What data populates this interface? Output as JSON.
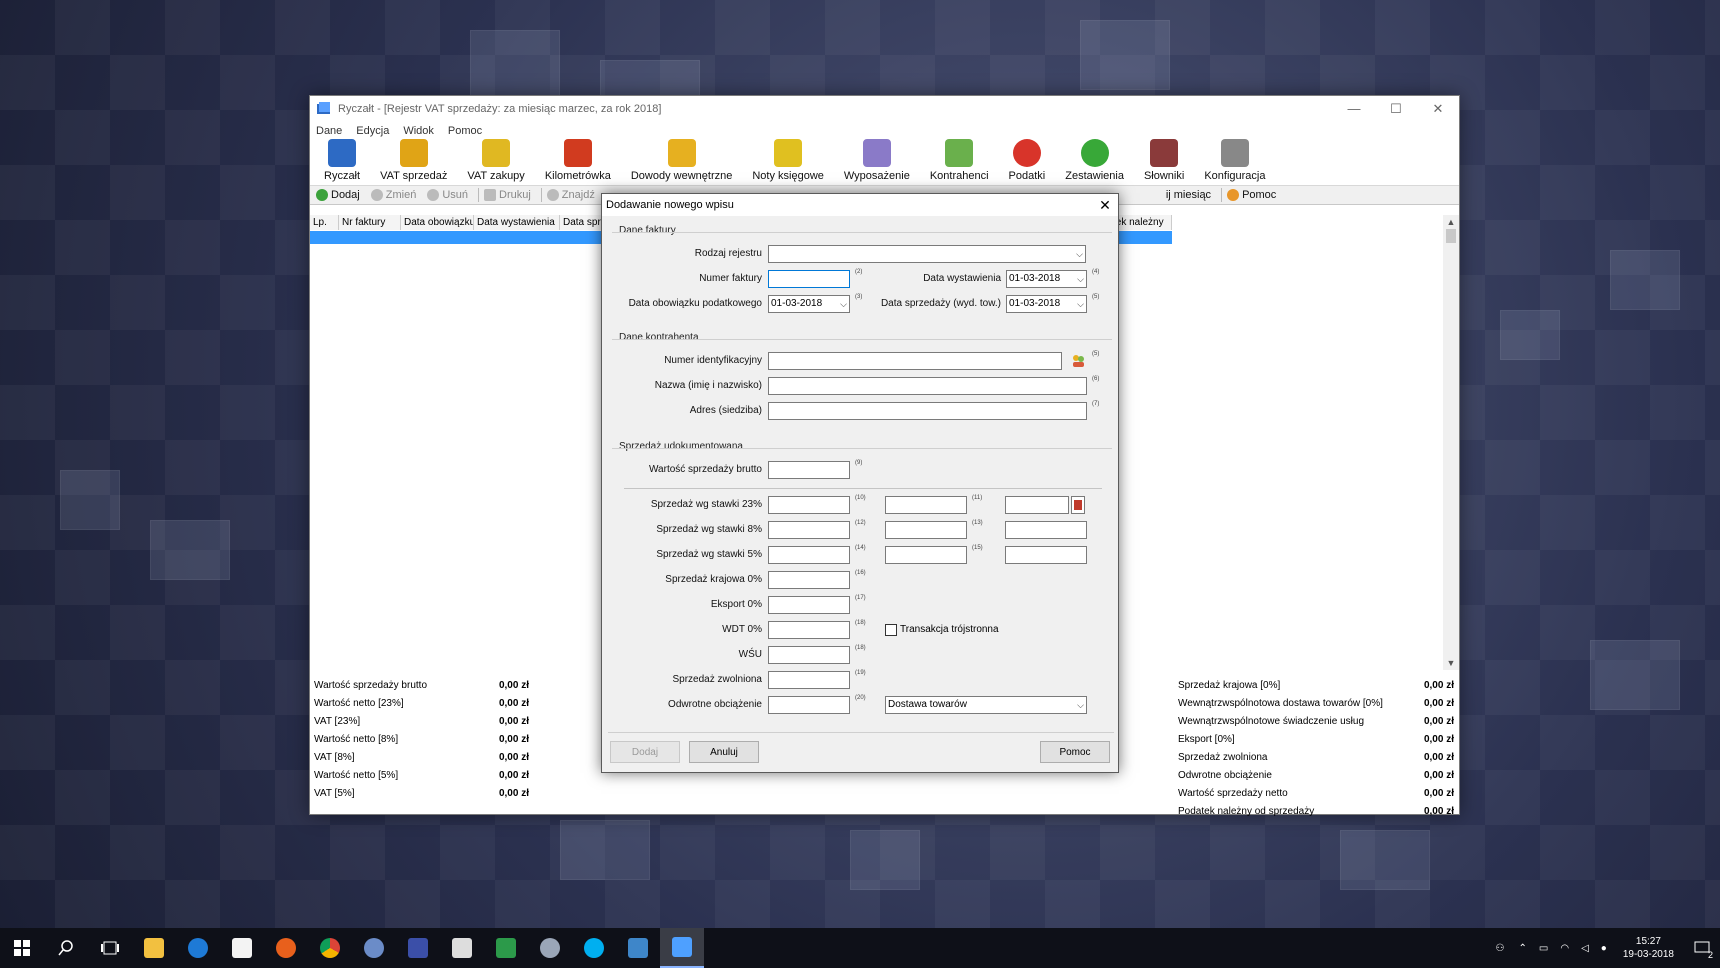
{
  "window": {
    "title": "Ryczałt - [Rejestr VAT sprzedaży: za miesiąc marzec, za rok 2018]",
    "menu": [
      "Dane",
      "Edycja",
      "Widok",
      "Pomoc"
    ],
    "toolbar": [
      {
        "label": "Ryczałt",
        "icon": "ryczalt-book-icon",
        "color": "#2d6ac4"
      },
      {
        "label": "VAT sprzedaż",
        "icon": "vat-sales-icon",
        "color": "#e0a416"
      },
      {
        "label": "VAT zakupy",
        "icon": "vat-purchases-icon",
        "color": "#e0b822"
      },
      {
        "label": "Kilometrówka",
        "icon": "car-icon",
        "color": "#d13b1f"
      },
      {
        "label": "Dowody wewnętrzne",
        "icon": "internal-docs-icon",
        "color": "#e6b020"
      },
      {
        "label": "Noty księgowe",
        "icon": "notes-icon",
        "color": "#e0c020"
      },
      {
        "label": "Wyposażenie",
        "icon": "equipment-icon",
        "color": "#8a7ac8"
      },
      {
        "label": "Kontrahenci",
        "icon": "contractors-icon",
        "color": "#6ab04c"
      },
      {
        "label": "Podatki",
        "icon": "taxes-icon",
        "color": "#d8342a"
      },
      {
        "label": "Zestawienia",
        "icon": "reports-icon",
        "color": "#38a838"
      },
      {
        "label": "Słowniki",
        "icon": "dictionary-icon",
        "color": "#8a3a3a"
      },
      {
        "label": "Konfiguracja",
        "icon": "wrench-icon",
        "color": "#888888"
      }
    ],
    "actions": {
      "add": "Dodaj",
      "edit": "Zmień",
      "delete": "Usuń",
      "print": "Drukuj",
      "find": "Znajdź",
      "month": "ij miesiąc",
      "help": "Pomoc"
    },
    "grid_headers": [
      "Lp.",
      "Nr faktury",
      "Data obowiązku",
      "Data wystawienia",
      "Data sprz",
      "tek należny"
    ],
    "summary_left": [
      {
        "label": "Wartość sprzedaży brutto",
        "value": "0,00 zł"
      },
      {
        "label": "Wartość netto [23%]",
        "value": "0,00 zł"
      },
      {
        "label": "VAT [23%]",
        "value": "0,00 zł"
      },
      {
        "label": "Wartość netto [8%]",
        "value": "0,00 zł"
      },
      {
        "label": "VAT [8%]",
        "value": "0,00 zł"
      },
      {
        "label": "Wartość netto [5%]",
        "value": "0,00 zł"
      },
      {
        "label": "VAT [5%]",
        "value": "0,00 zł"
      }
    ],
    "summary_right": [
      {
        "label": "Sprzedaż krajowa [0%]",
        "value": "0,00 zł"
      },
      {
        "label": "Wewnątrzwspólnotowa dostawa towarów [0%]",
        "value": "0,00 zł"
      },
      {
        "label": "Wewnątrzwspólnotowe świadczenie usług",
        "value": "0,00 zł"
      },
      {
        "label": "Eksport [0%]",
        "value": "0,00 zł"
      },
      {
        "label": "Sprzedaż zwolniona",
        "value": "0,00 zł"
      },
      {
        "label": "Odwrotne obciążenie",
        "value": "0,00 zł"
      },
      {
        "label": "Wartość sprzedaży netto",
        "value": "0,00 zł"
      },
      {
        "label": "Podatek należny od sprzedaży",
        "value": "0,00 zł"
      }
    ]
  },
  "dialog": {
    "title": "Dodawanie nowego wpisu",
    "sec_invoice": "Dane faktury",
    "sec_contractor": "Dane kontrahenta",
    "sec_sales": "Sprzedaż udokumentowana",
    "lbl_register_type": "Rodzaj rejestru",
    "lbl_invoice_no": "Numer faktury",
    "lbl_issue_date": "Data wystawienia",
    "lbl_tax_date": "Data obowiązku podatkowego",
    "lbl_sale_date": "Data sprzedaży (wyd. tow.)",
    "issue_date": "01-03-2018",
    "tax_date": "01-03-2018",
    "sale_date": "01-03-2018",
    "lbl_tax_id": "Numer identyfikacyjny",
    "lbl_name": "Nazwa (imię i nazwisko)",
    "lbl_address": "Adres (siedziba)",
    "lbl_gross": "Wartość sprzedaży brutto",
    "lbl_23": "Sprzedaż wg stawki 23%",
    "lbl_8": "Sprzedaż wg stawki 8%",
    "lbl_5": "Sprzedaż wg stawki 5%",
    "lbl_dom0": "Sprzedaż krajowa 0%",
    "lbl_export": "Eksport 0%",
    "lbl_wdt": "WDT 0%",
    "lbl_wsu": "WŚU",
    "lbl_exempt": "Sprzedaż zwolniona",
    "lbl_reverse": "Odwrotne obciążenie",
    "chk_triangular": "Transakcja trójstronna",
    "reverse_type": "Dostawa towarów",
    "nums": {
      "n2": "(2)",
      "n3": "(3)",
      "n4": "(4)",
      "n5a": "(5)",
      "n5b": "(5)",
      "n5c": "(5)",
      "n6": "(6)",
      "n7": "(7)",
      "n9": "(9)",
      "n10": "(10)",
      "n11": "(11)",
      "n12": "(12)",
      "n13": "(13)",
      "n14": "(14)",
      "n15": "(15)",
      "n16": "(16)",
      "n17": "(17)",
      "n18a": "(18)",
      "n18b": "(18)",
      "n19": "(19)",
      "n20": "(20)"
    },
    "btn_add": "Dodaj",
    "btn_cancel": "Anuluj",
    "btn_help": "Pomoc"
  },
  "taskbar": {
    "time": "15:27",
    "date": "19-03-2018",
    "notifications": "2"
  }
}
